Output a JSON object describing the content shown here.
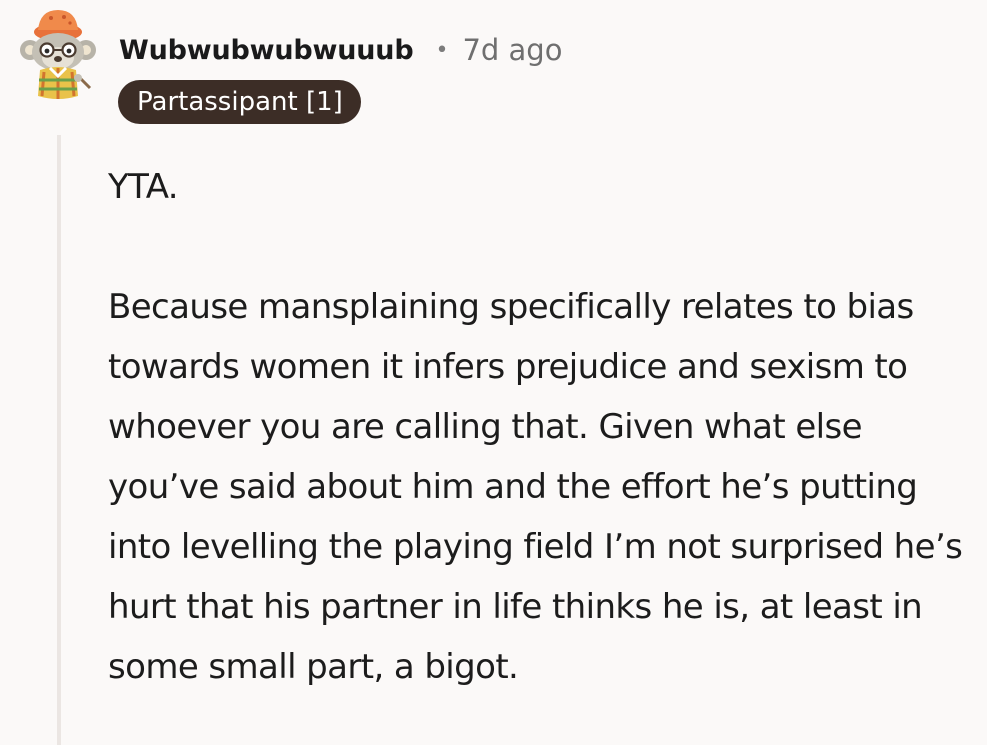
{
  "comment": {
    "author": "Wubwubwubwuuub",
    "separator": "•",
    "age": "7d ago",
    "flair": "Partassipant [1]",
    "paragraphs": [
      "YTA.",
      "Because mansplaining specifically relates to bias towards women it infers prejudice and sexism to whoever you are calling that. Given what else you’ve said about him and the effort he’s putting into levelling the playing field I’m not surprised he’s hurt that his partner in life thinks he is, at least in some small part, a bigot."
    ],
    "avatar_icon": "koala-avatar-icon",
    "colors": {
      "flair_bg": "#3c2d26",
      "flair_text": "#ffffff",
      "background": "#fbf9f8",
      "thread_line": "#ebe6e3"
    }
  }
}
